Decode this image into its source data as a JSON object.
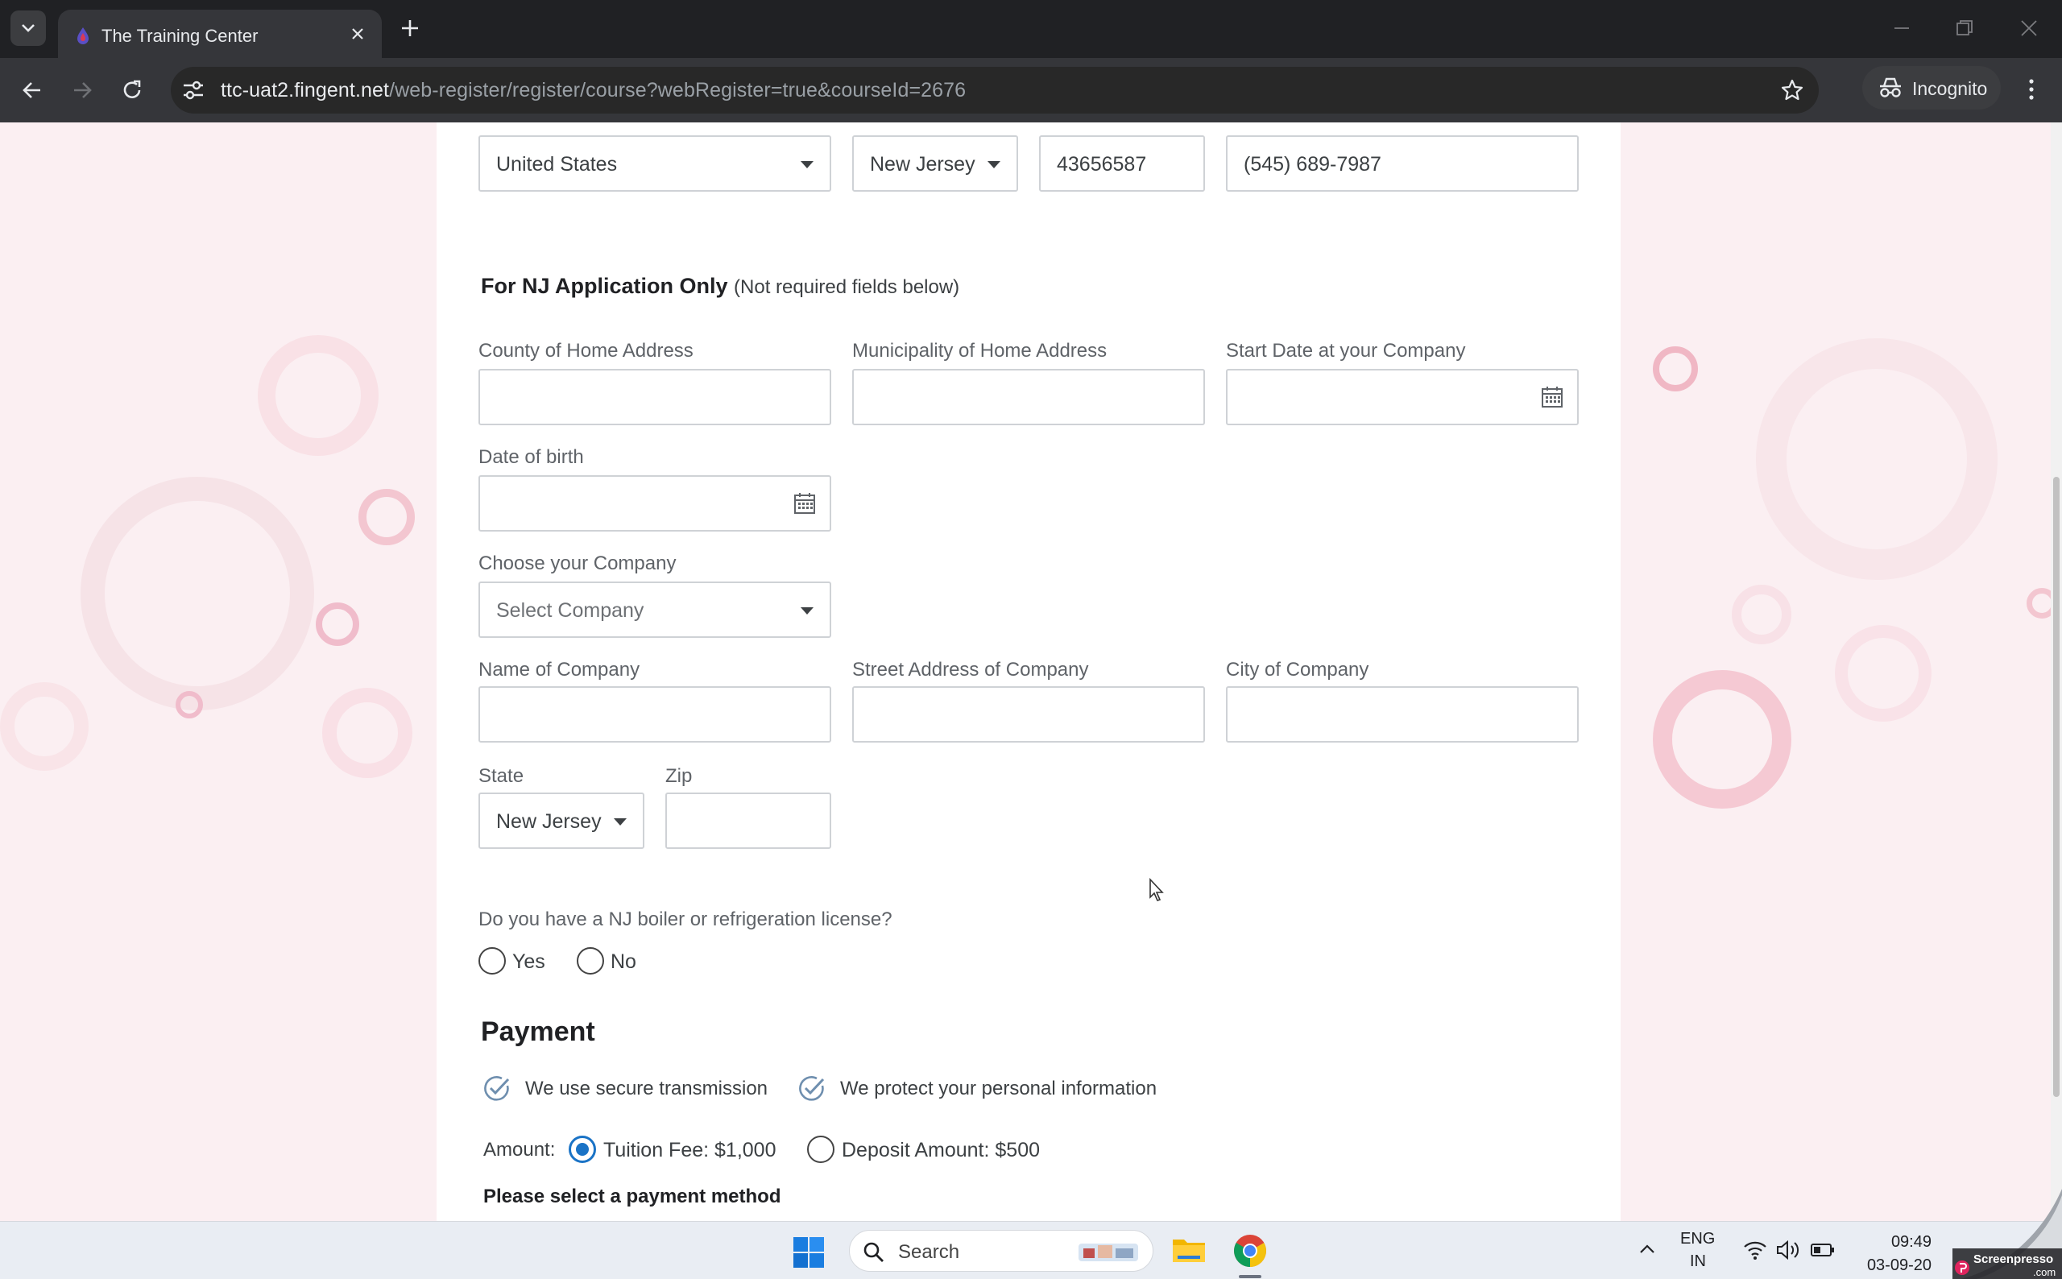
{
  "browser": {
    "tab_title": "The Training Center",
    "url_host": "ttc-uat2.fingent.net",
    "url_path": "/web-register/register/course?webRegister=true&courseId=2676",
    "incognito_label": "Incognito"
  },
  "contact_row": {
    "country_value": "United States",
    "state_value": "New Jersey",
    "zip_value": "43656587",
    "cell_value": "(545) 689-7987"
  },
  "nj_section": {
    "title": "For NJ Application Only",
    "subtitle": "(Not required fields below)",
    "county_label": "County of Home Address",
    "municipality_label": "Municipality of Home Address",
    "start_date_label": "Start Date at your Company",
    "dob_label": "Date of birth",
    "choose_company_label": "Choose your Company",
    "choose_company_placeholder": "Select Company",
    "company_name_label": "Name of Company",
    "company_street_label": "Street Address of Company",
    "company_city_label": "City of Company",
    "company_state_label": "State",
    "company_state_value": "New Jersey",
    "company_zip_label": "Zip",
    "license_question": "Do you have a NJ boiler or refrigeration license?",
    "yes_label": "Yes",
    "no_label": "No"
  },
  "payment": {
    "title": "Payment",
    "secure1": "We use secure transmission",
    "secure2": "We protect your personal information",
    "amount_label": "Amount:",
    "tuition_option": "Tuition Fee: $1,000",
    "deposit_option": "Deposit Amount: $500",
    "selected_option": "tuition",
    "method_prompt": "Please select a payment method"
  },
  "taskbar": {
    "search_placeholder": "Search",
    "lang_top": "ENG",
    "lang_bottom": "IN",
    "time": "09:49",
    "date": "03-09-20"
  },
  "colors": {
    "accent": "#1a73c6",
    "page_bg": "#fbeff2",
    "chrome_dark": "#202124"
  }
}
